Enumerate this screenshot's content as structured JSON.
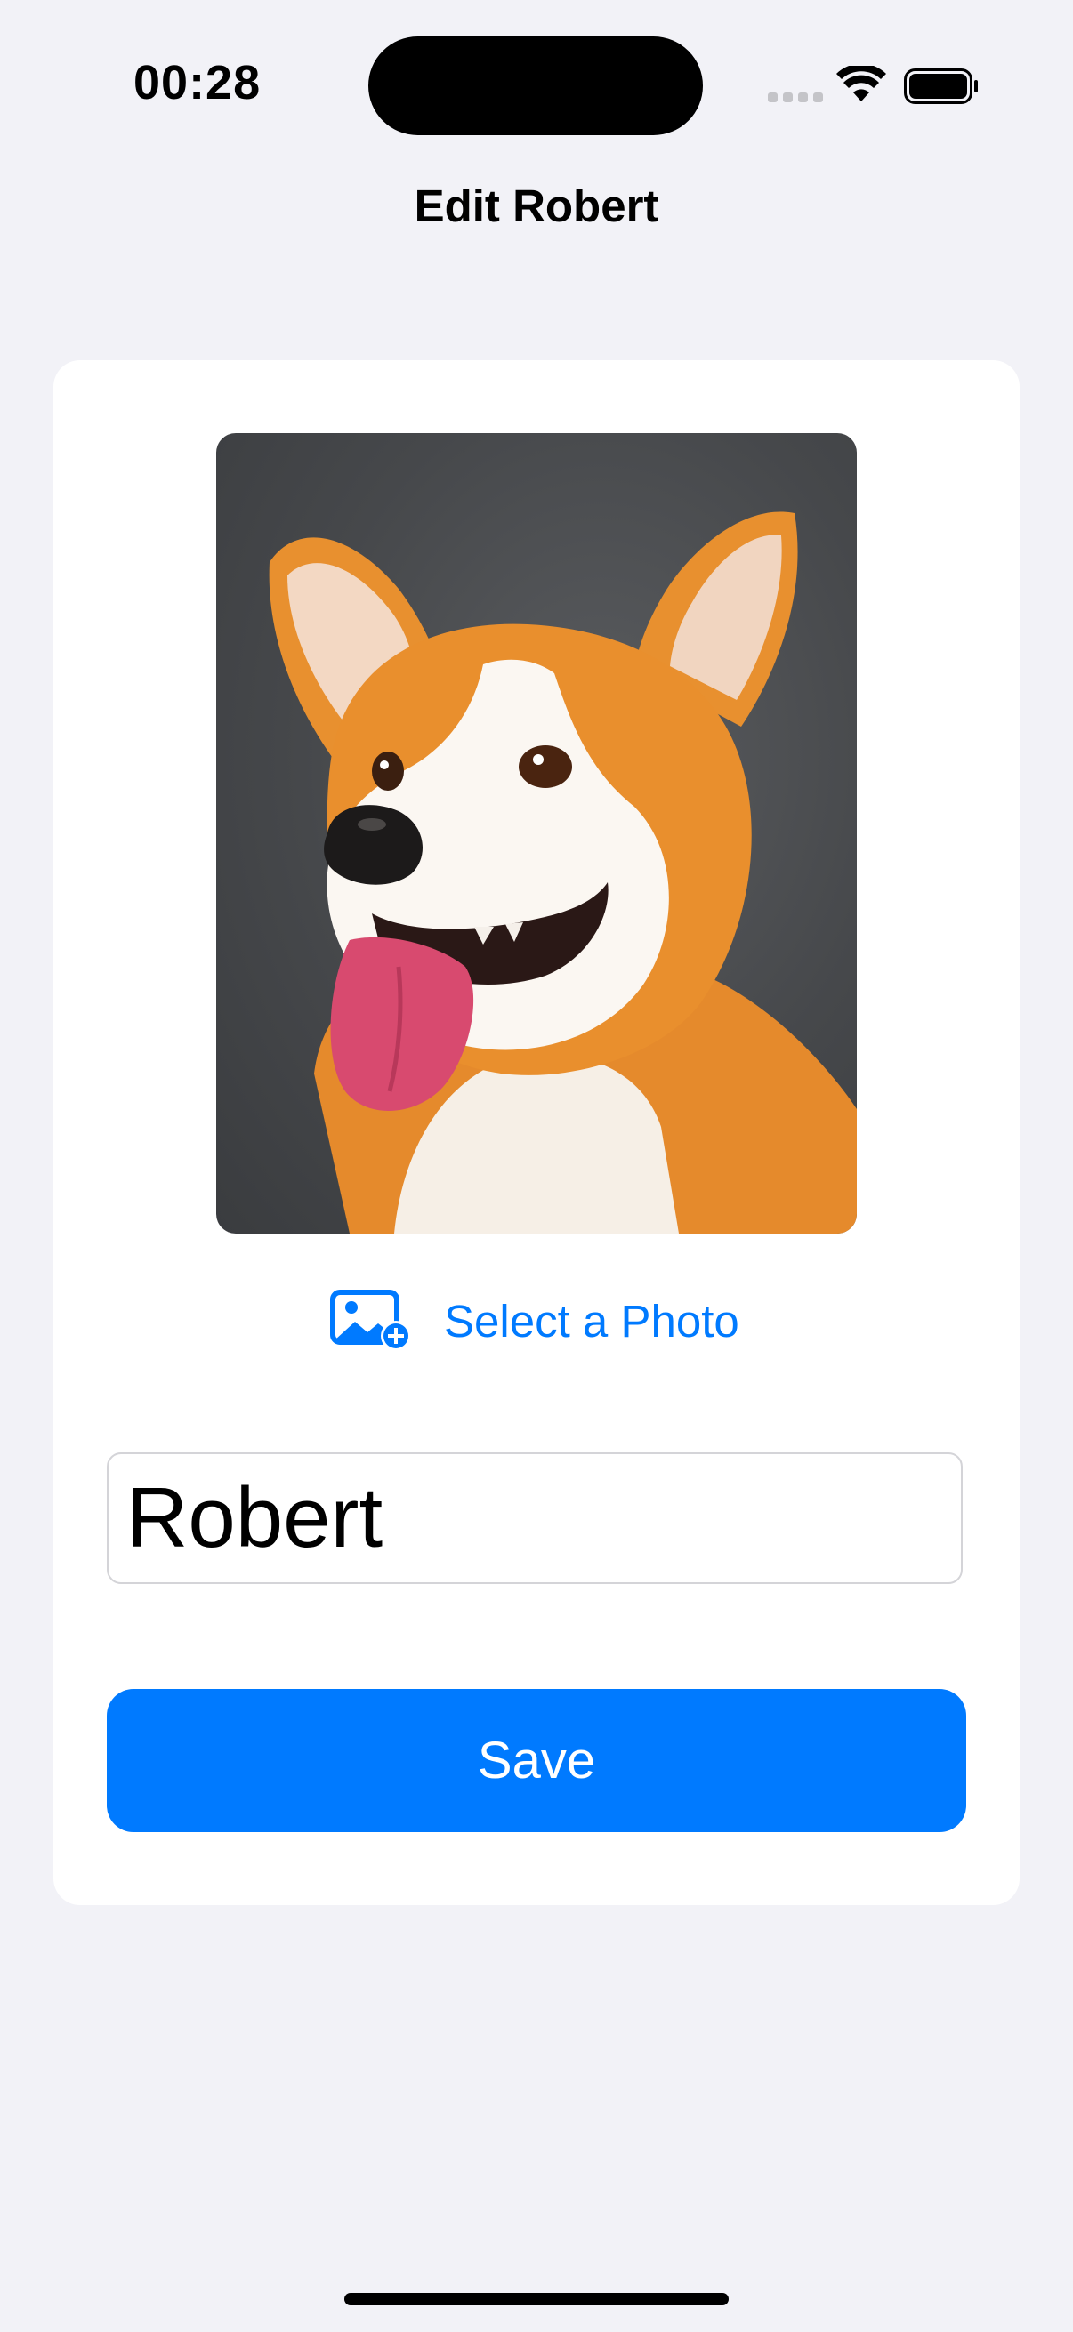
{
  "status_bar": {
    "time": "00:28",
    "icons": [
      "cellular-signal-icon",
      "wifi-icon",
      "battery-icon"
    ]
  },
  "nav": {
    "title": "Edit Robert"
  },
  "editor": {
    "photo": {
      "subject": "corgi-dog-photo"
    },
    "select_photo": {
      "label": "Select a Photo",
      "icon": "photo-badge-plus-icon"
    },
    "name_field": {
      "value": "Robert"
    },
    "save_label": "Save"
  },
  "colors": {
    "accent": "#007aff",
    "background": "#f2f2f7",
    "card": "#ffffff"
  }
}
